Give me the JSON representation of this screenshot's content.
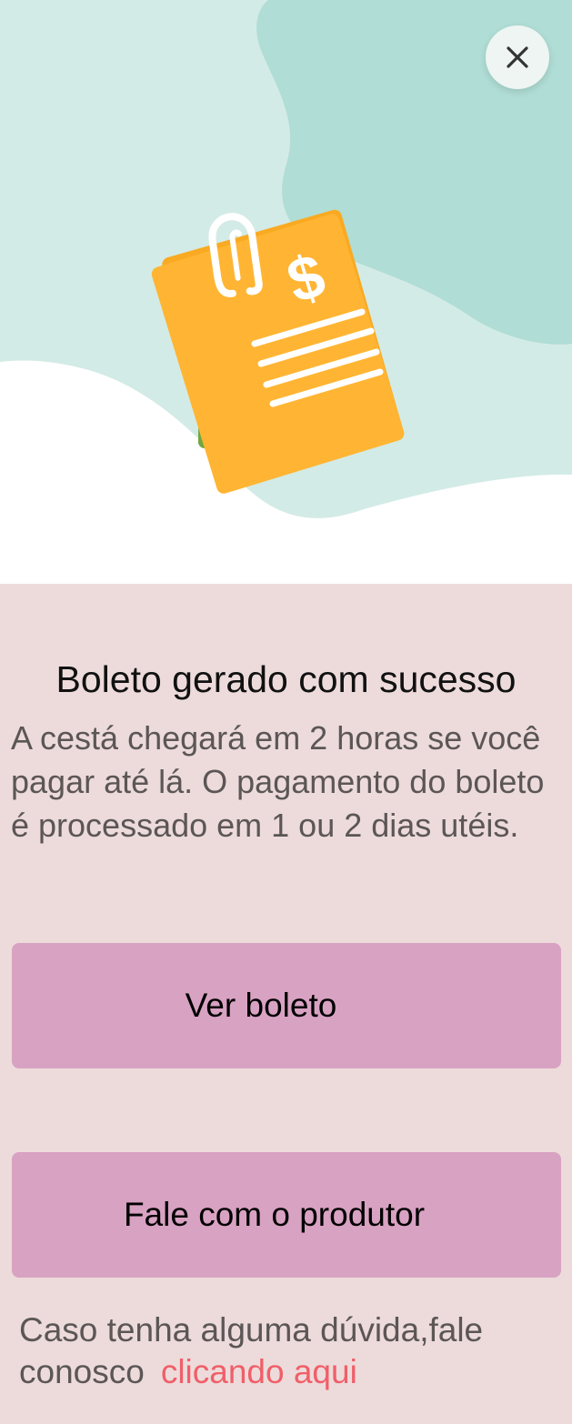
{
  "dialog": {
    "close_icon": "close-icon",
    "illustration_icon": "boleto-document-icon",
    "title": "Boleto gerado com sucesso",
    "description": " A cestá chegará em  2 horas se você pagar até lá. O pagamento do boleto é processado em 1 ou 2 dias utéis.",
    "buttons": {
      "view_boleto": "Ver boleto",
      "contact_producer": "Fale com o produtor"
    },
    "footer": {
      "text": "Caso tenha alguma dúvida,fale conosco",
      "link": "clicando aqui"
    }
  },
  "colors": {
    "hero_blob_light": "#d3ebe6",
    "hero_blob_dark": "#b0ddd5",
    "document": "#ffb533",
    "panel_background": "#eddbdb",
    "button": "#d8a2c2",
    "link": "#f05f69"
  }
}
